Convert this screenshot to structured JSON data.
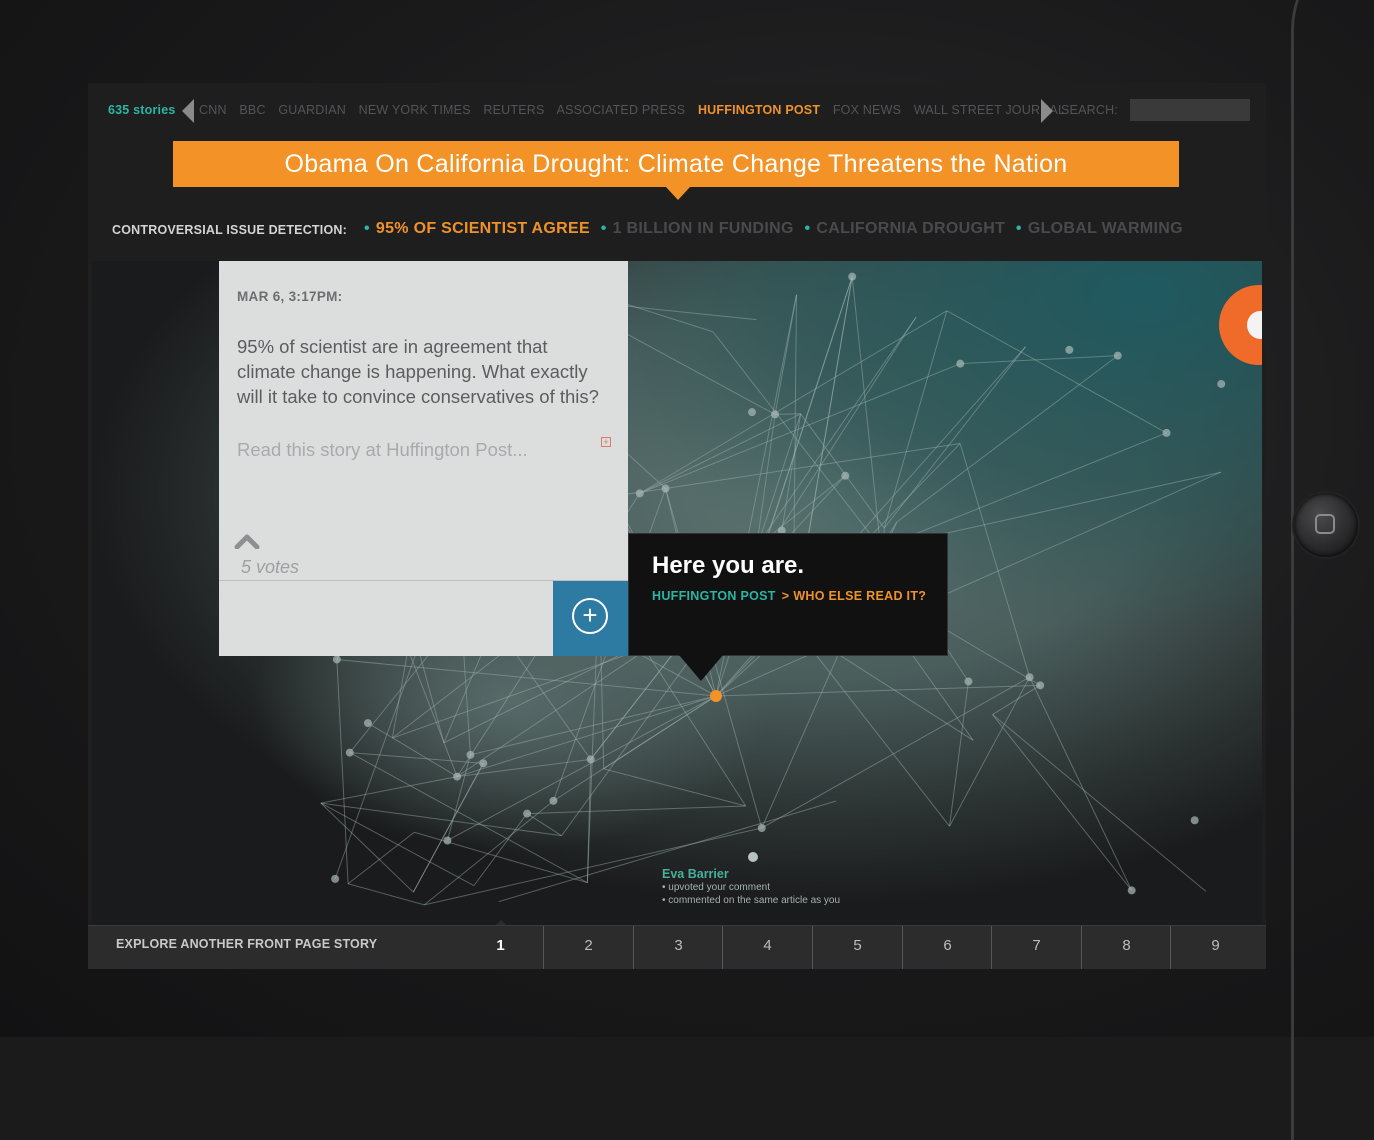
{
  "topnav": {
    "story_count": "635 stories",
    "sources": [
      "CNN",
      "BBC",
      "GUARDIAN",
      "NEW YORK TIMES",
      "REUTERS",
      "ASSOCIATED PRESS",
      "HUFFINGTON POST",
      "FOX NEWS",
      "WALL STREET JOURNAL"
    ],
    "active_source": "HUFFINGTON POST",
    "search_label": "SEARCH:",
    "search_value": ""
  },
  "headline": "Obama On California Drought: Climate Change Threatens the Nation",
  "issues": {
    "label": "CONTROVERSIAL ISSUE DETECTION:",
    "items": [
      "95% OF SCIENTIST AGREE",
      "1 BILLION IN FUNDING",
      "CALIFORNIA  DROUGHT",
      "GLOBAL WARMING"
    ],
    "active_item": "95% OF SCIENTIST AGREE"
  },
  "comment": {
    "date": "MAR 6, 3:17PM:",
    "body": "95% of scientist are in agreement that climate change is happening. What exactly will it take to convince conservatives of this?",
    "read_more": "Read this story at Huffington Post...",
    "expand_glyph": "+",
    "votes": "5 votes",
    "add_glyph": "+"
  },
  "tooltip": {
    "title": "Here you are.",
    "source": "HUFFINGTON POST",
    "separator": ">",
    "action": "WHO ELSE READ IT?"
  },
  "user": {
    "name": "Eva Barrier",
    "lines": [
      "• upvoted your comment",
      "• commented on the same article as you"
    ]
  },
  "bottombar": {
    "label": "EXPLORE ANOTHER FRONT PAGE STORY",
    "pages": [
      "1",
      "2",
      "3",
      "4",
      "5",
      "6",
      "7",
      "8",
      "9"
    ],
    "active_page": "1"
  },
  "colors": {
    "accent_orange": "#f39226",
    "accent_teal": "#2bb5a3",
    "button_blue": "#2d7aa3"
  }
}
